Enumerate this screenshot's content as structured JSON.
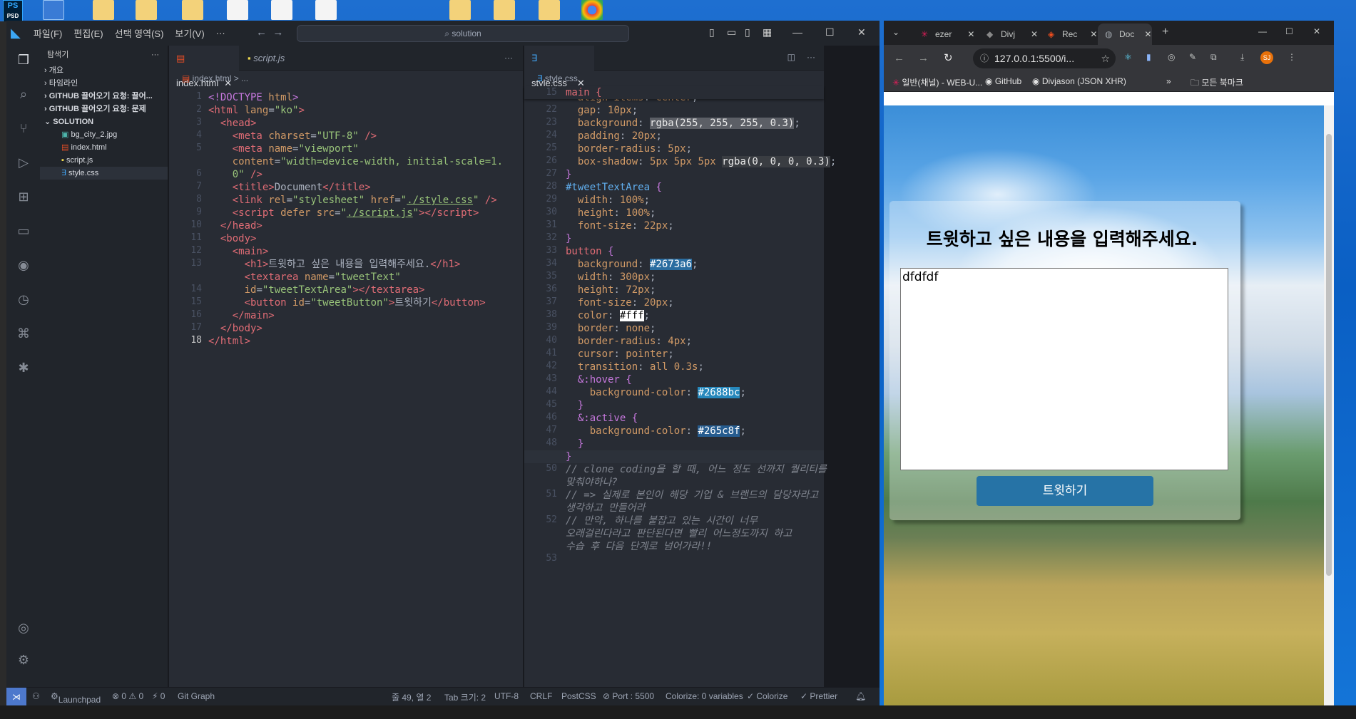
{
  "desktop": {
    "ps_label": "PS"
  },
  "vscode": {
    "menus": [
      "파일(F)",
      "편집(E)",
      "선택 영역(S)",
      "보기(V)",
      "···"
    ],
    "command_center": "solution",
    "explorer": {
      "title": "탐색기",
      "sections": [
        "개요",
        "타임라인",
        "GITHUB 끌어오기 요청: 끌어...",
        "GITHUB 끌어오기 요청: 문제",
        "SOLUTION"
      ],
      "files": [
        "bg_city_2.jpg",
        "index.html",
        "script.js",
        "style.css"
      ]
    },
    "left_group": {
      "tabs": [
        "index.html",
        "script.js"
      ],
      "breadcrumb": "index.html > ...",
      "line_numbers": [
        "1",
        "2",
        "3",
        "4",
        "5",
        "",
        "6",
        "7",
        "8",
        "9",
        "10",
        "11",
        "12",
        "13",
        "",
        "14",
        "15",
        "16",
        "17",
        "18"
      ]
    },
    "right_group": {
      "tab": "style.css",
      "breadcrumb": "style.css",
      "sticky_line": "15",
      "sticky_text": "main {",
      "line_numbers": [
        "21",
        "22",
        "23",
        "24",
        "25",
        "26",
        "27",
        "28",
        "29",
        "30",
        "31",
        "32",
        "33",
        "34",
        "35",
        "36",
        "37",
        "38",
        "39",
        "40",
        "41",
        "42",
        "43",
        "44",
        "45",
        "46",
        "47",
        "48",
        "49",
        "50",
        "",
        "51",
        "",
        "52",
        "",
        "",
        "53"
      ]
    },
    "statusbar": {
      "launchpad": "Launchpad",
      "errors": "⊗ 0 ⚠ 0",
      "ports": "⚡ 0",
      "git_graph": "Git Graph",
      "position": "줄 49, 열 2",
      "tab_size": "Tab 크기: 2",
      "encoding": "UTF-8",
      "eol": "CRLF",
      "language": "PostCSS",
      "port": "⊘ Port : 5500",
      "colorize_vars": "Colorize: 0 variables",
      "colorize": "✓ Colorize",
      "prettier": "✓ Prettier"
    }
  },
  "chrome": {
    "tabs": [
      "ezer",
      "Divj",
      "Rec",
      "Doc"
    ],
    "url": "127.0.0.1:5500/i...",
    "bookmarks": [
      "일반(채널) - WEB-U...",
      "GitHub",
      "Divjason (JSON XHR)",
      "모든 북마크"
    ],
    "page": {
      "heading": "트윗하고 싶은 내용을 입력해주세요.",
      "textarea_value": "dfdfdf",
      "button_label": "트윗하기"
    }
  }
}
